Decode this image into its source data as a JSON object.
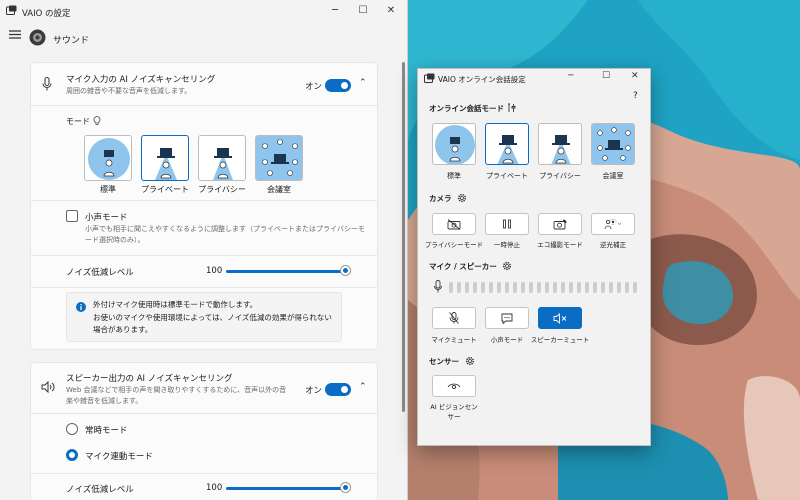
{
  "settings": {
    "window_title": "VAIO の設定",
    "page_title": "サウンド",
    "mic_section": {
      "title": "マイク入力の AI ノイズキャンセリング",
      "subtitle": "周囲の雑音や不要な音声を低減します。",
      "toggle_label": "オン",
      "mode_label": "モード",
      "modes": [
        "標準",
        "プライベート",
        "プライバシー",
        "会議室"
      ],
      "selected_mode": "プライベート",
      "quiet_mode_title": "小声モード",
      "quiet_mode_desc": "小声でも相手に聞こえやすくなるように調整します（プライベートまたはプライバシーモード選択時のみ）。",
      "level_label": "ノイズ低減レベル",
      "level_value": "100",
      "level_fraction": 1.0,
      "info_line1": "外付けマイク使用時は標準モードで動作します。",
      "info_line2": "お使いのマイクや使用環境によっては、ノイズ低減の効果が得られない場合があります。"
    },
    "speaker_section": {
      "title": "スピーカー出力の AI ノイズキャンセリング",
      "subtitle": "Web 会議などで相手の声を聞き取りやすくするために、音声以外の音楽や雑音を低減します。",
      "toggle_label": "オン",
      "radio_always": "常時モード",
      "radio_linked": "マイク連動モード",
      "selected_radio": "マイク連動モード",
      "level_label": "ノイズ低減レベル",
      "level_value": "100",
      "level_fraction": 1.0
    }
  },
  "dialog": {
    "title": "VAIO オンライン会話設定",
    "help": "?",
    "section_mode": "オンライン会話モード",
    "modes": [
      "標準",
      "プライベート",
      "プライバシー",
      "会議室"
    ],
    "selected_mode": "プライベート",
    "section_camera": "カメラ",
    "camera_buttons": [
      "プライバシーモード",
      "一時停止",
      "エコ撮影モード",
      "逆光補正"
    ],
    "section_mic": "マイク / スピーカー",
    "mic_buttons": [
      "マイクミュート",
      "小声モード",
      "スピーカーミュート"
    ],
    "active_mic_button": "スピーカーミュート",
    "section_sensor": "センサー",
    "sensor_buttons": [
      "AI ビジョンセンサー"
    ]
  },
  "colors": {
    "accent": "#0b6cc4",
    "mode_highlight": "#8fc4ec",
    "window_bg": "#f3f3f3",
    "card_bg": "#fbfbfb"
  }
}
